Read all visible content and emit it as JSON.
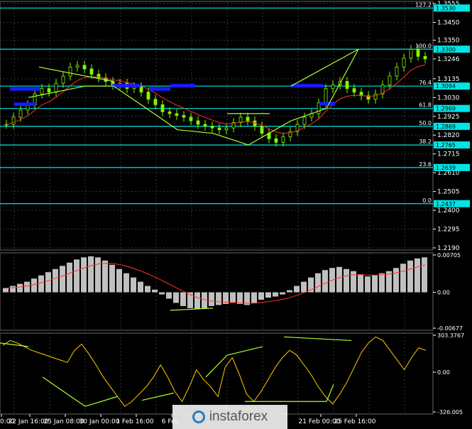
{
  "colors": {
    "background": "#000000",
    "grid": "#2a3a3a",
    "fib_line": "#00e5e5",
    "candle": "#7cfc00",
    "trend": "#adff2f",
    "signal_red": "#ff3030",
    "hist": "#c0c0c0",
    "osc": "#ffcc00",
    "blue_zone": "#1a1aff"
  },
  "logo": {
    "text": "instaforex",
    "icon": "circle-logo-icon"
  },
  "chart_data": [
    {
      "type": "candlestick",
      "price_ticks": [
        "1.3555",
        "1.3450",
        "1.3350",
        "1.3246",
        "1.3135",
        "1.3030",
        "1.2925",
        "1.2820",
        "1.2715",
        "1.2610",
        "1.2505",
        "1.2400",
        "1.2295",
        "1.2190"
      ],
      "ylim": [
        1.219,
        1.3555
      ],
      "fib_levels": [
        {
          "pct": "127.2",
          "value": "1.3530"
        },
        {
          "pct": "100.0",
          "value": "1.3300"
        },
        {
          "pct": "76.4",
          "value": "1.3094"
        },
        {
          "pct": "61.8",
          "value": "1.2969"
        },
        {
          "pct": "50.0",
          "value": "1.2869"
        },
        {
          "pct": "38.2",
          "value": "1.2765"
        },
        {
          "pct": "23.6",
          "value": "1.2639"
        },
        {
          "pct": "0.0",
          "value": "1.2437"
        }
      ],
      "current_price": "1.3246",
      "close_series": [
        1.288,
        1.292,
        1.296,
        1.299,
        1.305,
        1.308,
        1.306,
        1.311,
        1.315,
        1.32,
        1.321,
        1.319,
        1.316,
        1.314,
        1.312,
        1.31,
        1.311,
        1.308,
        1.309,
        1.306,
        1.302,
        1.299,
        1.295,
        1.294,
        1.293,
        1.292,
        1.29,
        1.288,
        1.287,
        1.286,
        1.285,
        1.286,
        1.289,
        1.292,
        1.29,
        1.287,
        1.283,
        1.28,
        1.278,
        1.281,
        1.284,
        1.288,
        1.292,
        1.294,
        1.3,
        1.308,
        1.31,
        1.312,
        1.308,
        1.306,
        1.304,
        1.302,
        1.305,
        1.31,
        1.315,
        1.32,
        1.325,
        1.33,
        1.326,
        1.3246
      ]
    },
    {
      "type": "bar",
      "name": "histogram",
      "ticks": [
        "0.00705",
        "0.00",
        "-0.00677"
      ],
      "ylim": [
        -0.00677,
        0.00705
      ],
      "values": [
        0.0008,
        0.0012,
        0.0016,
        0.002,
        0.0026,
        0.0032,
        0.0038,
        0.0044,
        0.005,
        0.0056,
        0.0062,
        0.0066,
        0.0068,
        0.0066,
        0.006,
        0.0052,
        0.0044,
        0.0036,
        0.0028,
        0.002,
        0.0012,
        0.0005,
        -0.0004,
        -0.0012,
        -0.002,
        -0.0026,
        -0.003,
        -0.0032,
        -0.003,
        -0.0026,
        -0.0024,
        -0.0022,
        -0.002,
        -0.0022,
        -0.0024,
        -0.002,
        -0.0014,
        -0.001,
        -0.0008,
        -0.0004,
        0.0004,
        0.0012,
        0.002,
        0.0028,
        0.0036,
        0.0042,
        0.0046,
        0.0048,
        0.0044,
        0.004,
        0.0034,
        0.003,
        0.0032,
        0.0036,
        0.004,
        0.0046,
        0.0054,
        0.006,
        0.0064,
        0.0066
      ]
    },
    {
      "type": "line",
      "name": "oscillator",
      "ticks": [
        "303.3767",
        "0.00",
        "-326.005"
      ],
      "ylim": [
        -326.005,
        303.3767
      ],
      "values": [
        220,
        260,
        240,
        210,
        180,
        160,
        140,
        120,
        100,
        80,
        180,
        230,
        150,
        60,
        -40,
        -120,
        -200,
        -280,
        -240,
        -180,
        -120,
        -40,
        60,
        -40,
        -160,
        -240,
        -120,
        20,
        -60,
        -120,
        -200,
        40,
        120,
        -20,
        -180,
        -240,
        -160,
        -60,
        40,
        120,
        180,
        140,
        60,
        -20,
        -120,
        -200,
        -260,
        -180,
        -80,
        40,
        160,
        240,
        290,
        260,
        180,
        100,
        20,
        120,
        200,
        180
      ],
      "x_tick_labels": [
        "0:00",
        "22 Jan 16:00",
        "25 Jan 08:00",
        "30 Jan 00:00",
        "1 Feb 16:00",
        "6 Feb",
        "21 Feb 00:00",
        "25 Feb 16:00"
      ]
    }
  ]
}
